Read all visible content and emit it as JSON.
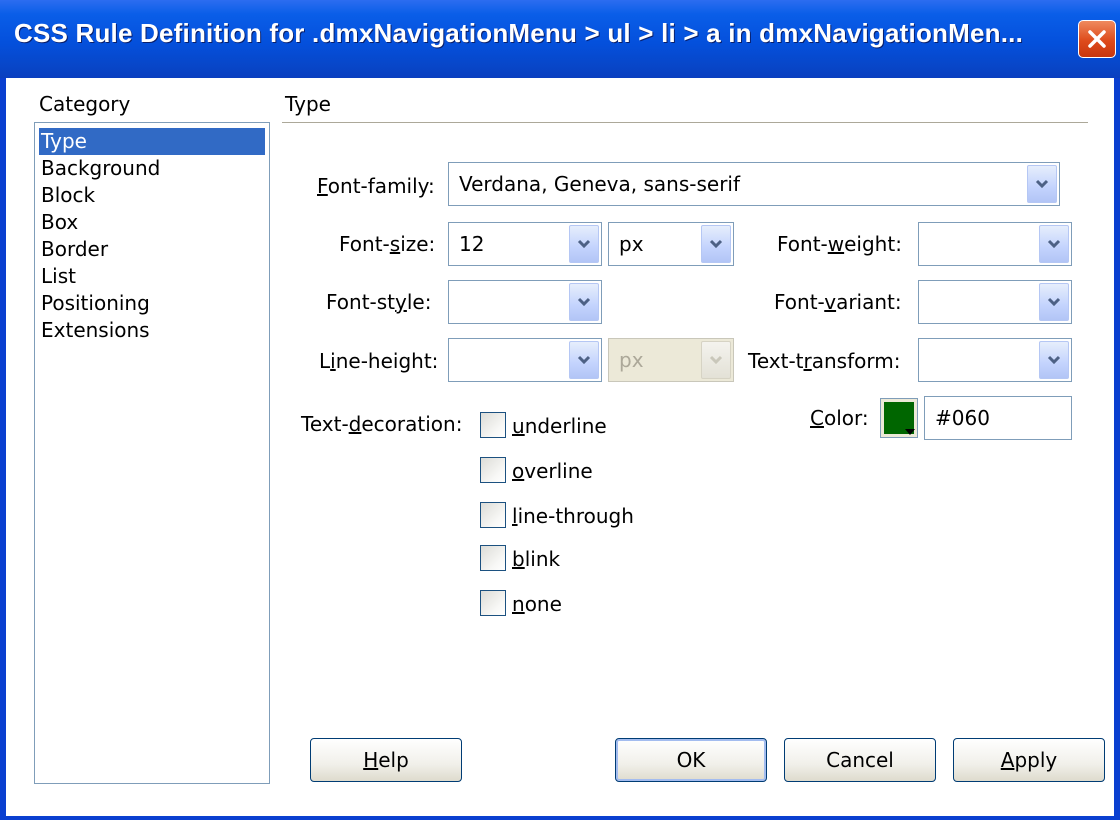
{
  "window": {
    "title": "CSS Rule Definition for .dmxNavigationMenu > ul > li > a in dmxNavigationMen..."
  },
  "category": {
    "label": "Category",
    "items": [
      "Type",
      "Background",
      "Block",
      "Box",
      "Border",
      "List",
      "Positioning",
      "Extensions"
    ],
    "selected": "Type"
  },
  "panel": {
    "title": "Type"
  },
  "fields": {
    "font_family": {
      "label_pre": "",
      "label_key": "F",
      "label_post": "ont-family:",
      "value": "Verdana, Geneva, sans-serif"
    },
    "font_size": {
      "label_pre": "Font-",
      "label_key": "s",
      "label_post": "ize:",
      "value": "12",
      "unit": "px"
    },
    "font_weight": {
      "label_pre": "Font-",
      "label_key": "w",
      "label_post": "eight:",
      "value": ""
    },
    "font_style": {
      "label_pre": "Font-st",
      "label_key": "y",
      "label_post": "le:",
      "value": ""
    },
    "font_variant": {
      "label_pre": "Font-",
      "label_key": "v",
      "label_post": "ariant:",
      "value": ""
    },
    "line_height": {
      "label_pre": "L",
      "label_key": "i",
      "label_post": "ne-height:",
      "value": "",
      "unit": "px"
    },
    "text_transform": {
      "label_pre": "Text-t",
      "label_key": "r",
      "label_post": "ansform:",
      "value": ""
    },
    "text_decoration": {
      "label_pre": "Text-",
      "label_key": "d",
      "label_post": "ecoration:"
    },
    "color": {
      "label_pre": "",
      "label_key": "C",
      "label_post": "olor:",
      "value": "#060",
      "swatch": "#006600"
    }
  },
  "decorations": [
    {
      "key": "u",
      "rest": "nderline",
      "checked": false
    },
    {
      "key": "o",
      "rest": "verline",
      "checked": false
    },
    {
      "key": "l",
      "rest": "ine-through",
      "checked": false
    },
    {
      "key": "b",
      "rest": "link",
      "checked": false
    },
    {
      "key": "n",
      "rest": "one",
      "checked": false
    }
  ],
  "buttons": {
    "help": {
      "key": "H",
      "rest": "elp"
    },
    "ok": "OK",
    "cancel": "Cancel",
    "apply": {
      "key": "A",
      "rest": "pply"
    }
  },
  "colors": {
    "title_bar": "#0a5ee8",
    "selection": "#316ac5",
    "close_button": "#de4b1b"
  }
}
